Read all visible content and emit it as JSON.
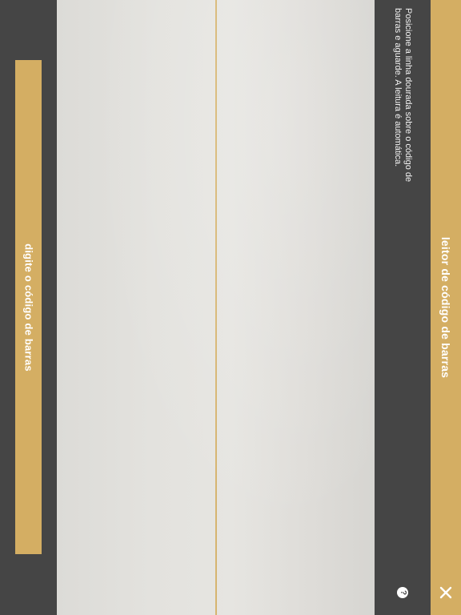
{
  "title_bar": {
    "title": "leitor de código de barras",
    "close_icon": "close-icon"
  },
  "info_panel": {
    "instructions": "Posicione a linha dourada sobre o código de barras e aguarde. A leitura é automática.",
    "help_icon": "help-icon",
    "help_glyph": "?"
  },
  "manual_entry": {
    "label": "digite o código de barras"
  },
  "colors": {
    "accent": "#d4ae63",
    "background": "#454545",
    "text": "#ffffff"
  }
}
